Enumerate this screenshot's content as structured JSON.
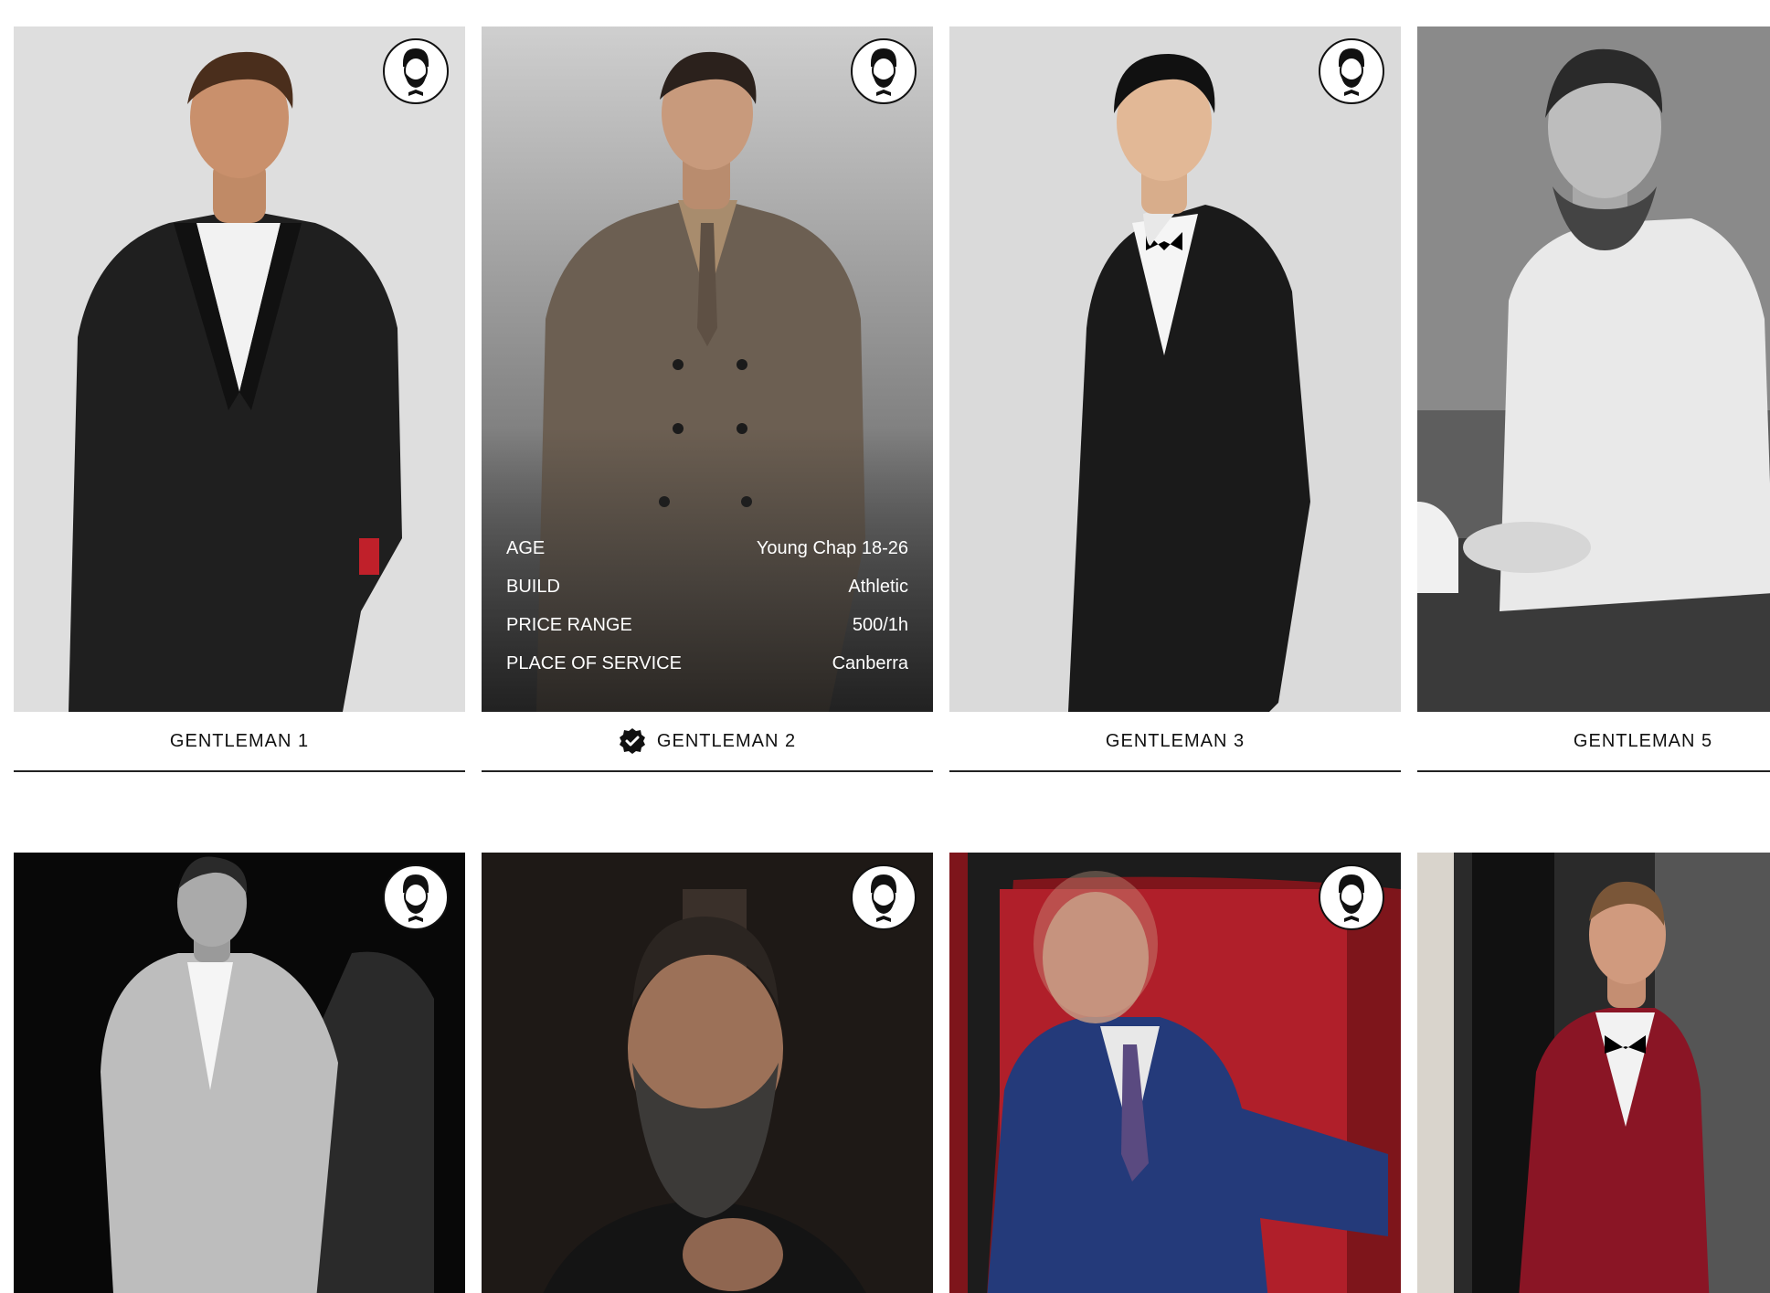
{
  "cards": [
    {
      "name": "GENTLEMAN 1",
      "verified": false,
      "photo_bg": "#dcdcdc",
      "suit_color": "#1e1e1e",
      "skin": "#c9906c",
      "hair": "#4a2e1c",
      "has_badge": true
    },
    {
      "name": "GENTLEMAN 2",
      "verified": true,
      "photo_bg": "#9a9a9a",
      "suit_color": "#6b5e51",
      "skin": "#c89a7c",
      "hair": "#2b211c",
      "has_badge": true,
      "details": [
        {
          "label": "AGE",
          "value": "Young Chap 18-26"
        },
        {
          "label": "BUILD",
          "value": "Athletic"
        },
        {
          "label": "PRICE RANGE",
          "value": "500/1h"
        },
        {
          "label": "PLACE OF SERVICE",
          "value": "Canberra"
        }
      ]
    },
    {
      "name": "GENTLEMAN 3",
      "verified": false,
      "photo_bg": "#d8d8d8",
      "suit_color": "#1a1a1a",
      "skin": "#e2b896",
      "hair": "#111111",
      "has_badge": true
    },
    {
      "name": "GENTLEMAN 5",
      "verified": false,
      "photo_bg": "#6a6a6a",
      "suit_color": "#e8e8e8",
      "skin": "#bdbdbd",
      "hair": "#2a2a2a",
      "has_badge": false
    }
  ],
  "row2": [
    {
      "photo_bg": "#080808",
      "suit_color": "#bdbdbd",
      "has_badge": true
    },
    {
      "photo_bg": "#1e1916",
      "suit_color": "#161616",
      "has_badge": true
    },
    {
      "photo_bg": "#8b1a1f",
      "suit_color": "#243a7a",
      "has_badge": true
    },
    {
      "photo_bg": "#2a2a2a",
      "suit_color": "#8a1525",
      "has_badge": false
    }
  ],
  "icons": {
    "badge": "gentleman-avatar-icon",
    "verified": "verified-check-icon"
  }
}
